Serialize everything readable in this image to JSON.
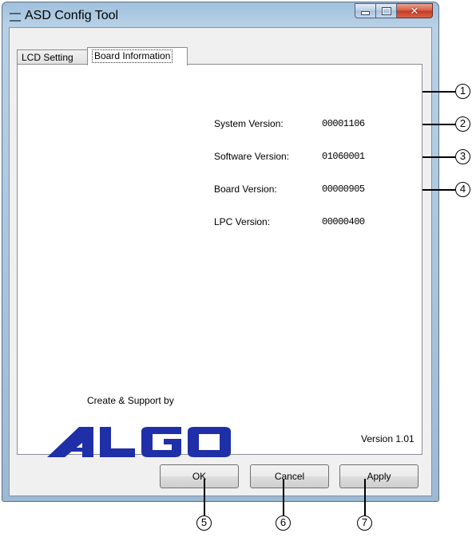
{
  "window": {
    "title": "ASD Config Tool"
  },
  "tabs": [
    {
      "label": "LCD Setting",
      "active": false
    },
    {
      "label": "Board Information",
      "active": true
    }
  ],
  "versions": [
    {
      "label": "System Version:",
      "value": "00001106",
      "marker": "1"
    },
    {
      "label": "Software Version:",
      "value": "01060001",
      "marker": "2"
    },
    {
      "label": "Board Version:",
      "value": "00000905",
      "marker": "3"
    },
    {
      "label": "LPC Version:",
      "value": "00000400",
      "marker": "4"
    }
  ],
  "footer": {
    "support_text": "Create & Support by",
    "logo_text": "ALGO",
    "version_text": "Version 1.01"
  },
  "buttons": [
    {
      "label": "OK",
      "marker": "5"
    },
    {
      "label": "Cancel",
      "marker": "6"
    },
    {
      "label": "Apply",
      "marker": "7"
    }
  ],
  "colors": {
    "logo": "#1f2fa8",
    "titlebar": "#b8d1e6",
    "close_button": "#c4391f"
  }
}
